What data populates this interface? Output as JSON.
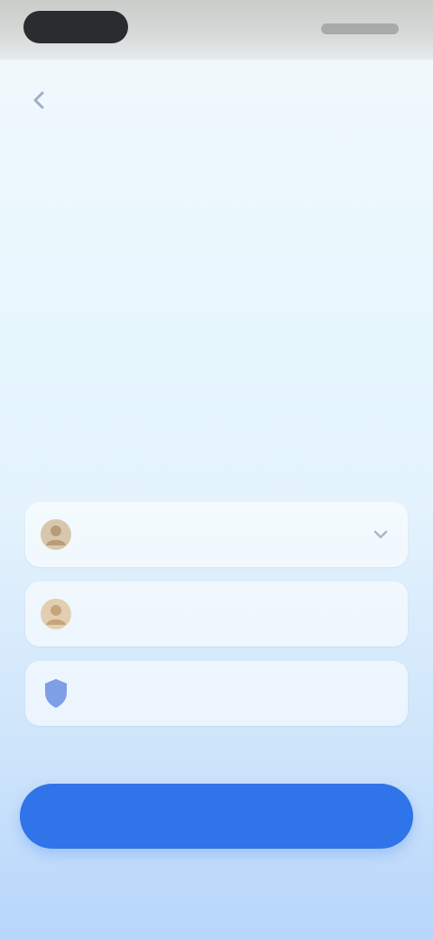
{
  "status_bar": {
    "time": "",
    "indicators": ""
  },
  "nav": {
    "title": "",
    "back_icon": "chevron-left-icon"
  },
  "hero": {
    "heading": ""
  },
  "subtitle": "",
  "options": [
    {
      "label": "",
      "icon": "person-avatar-icon",
      "icon_color": "#c9b295",
      "chevron_icon": "chevron-down-icon"
    },
    {
      "label": "",
      "icon": "person-avatar-icon",
      "icon_color": "#d4bd9a"
    },
    {
      "label": "",
      "icon": "shield-icon",
      "icon_color": "#7d9fe6"
    }
  ],
  "primary_action": {
    "label": "",
    "color": "#2f74e8"
  }
}
